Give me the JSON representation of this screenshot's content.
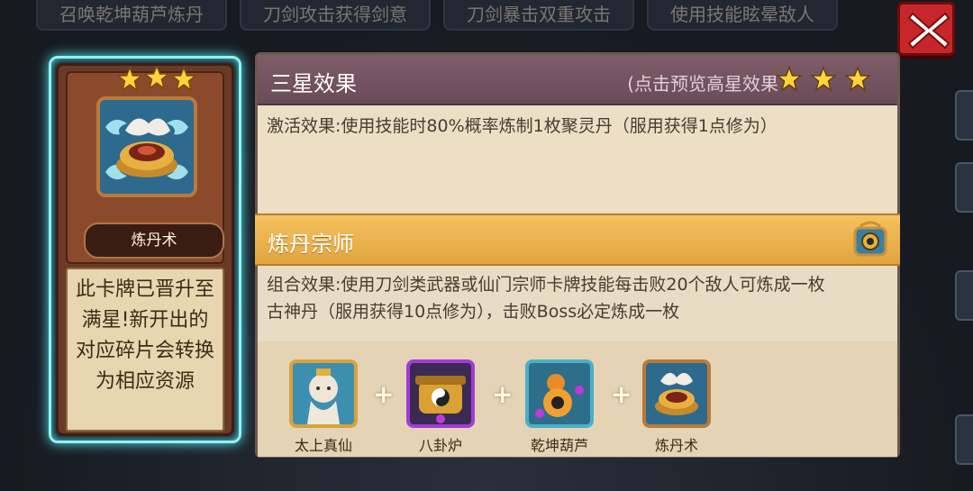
{
  "top_tabs": [
    {
      "label": "召唤乾坤葫芦炼丹"
    },
    {
      "label": "刀剑攻击获得剑意"
    },
    {
      "label": "刀剑暴击双重攻击"
    },
    {
      "label": "使用技能眩晕敌人"
    }
  ],
  "card": {
    "name": "炼丹术",
    "star_count": 3,
    "description": "此卡牌已晋升至满星!新开出的对应碎片会转换为相应资源"
  },
  "panel": {
    "title": "三星效果",
    "hint": "(点击预览高星效果",
    "star_count": 3,
    "activation_effect": "激活效果:使用技能时80%概率炼制1枚聚灵丹（服用获得1点修为）",
    "combo_title": "炼丹宗师",
    "combo_effect_line1": "组合效果:使用刀剑类武器或仙门宗师卡牌技能每击败20个敌人可炼成一枚",
    "combo_effect_line2": "古神丹（服用获得10点修为），击败Boss必定炼成一枚",
    "combo_cards": [
      {
        "label": "太上真仙"
      },
      {
        "label": "八卦炉"
      },
      {
        "label": "乾坤葫芦"
      },
      {
        "label": "炼丹术"
      }
    ],
    "plus_symbol": "+"
  },
  "colors": {
    "glow": "#8ef3f6",
    "header": "#6a4b57",
    "combo_band": "#f0b64f",
    "close": "#c7272a"
  }
}
